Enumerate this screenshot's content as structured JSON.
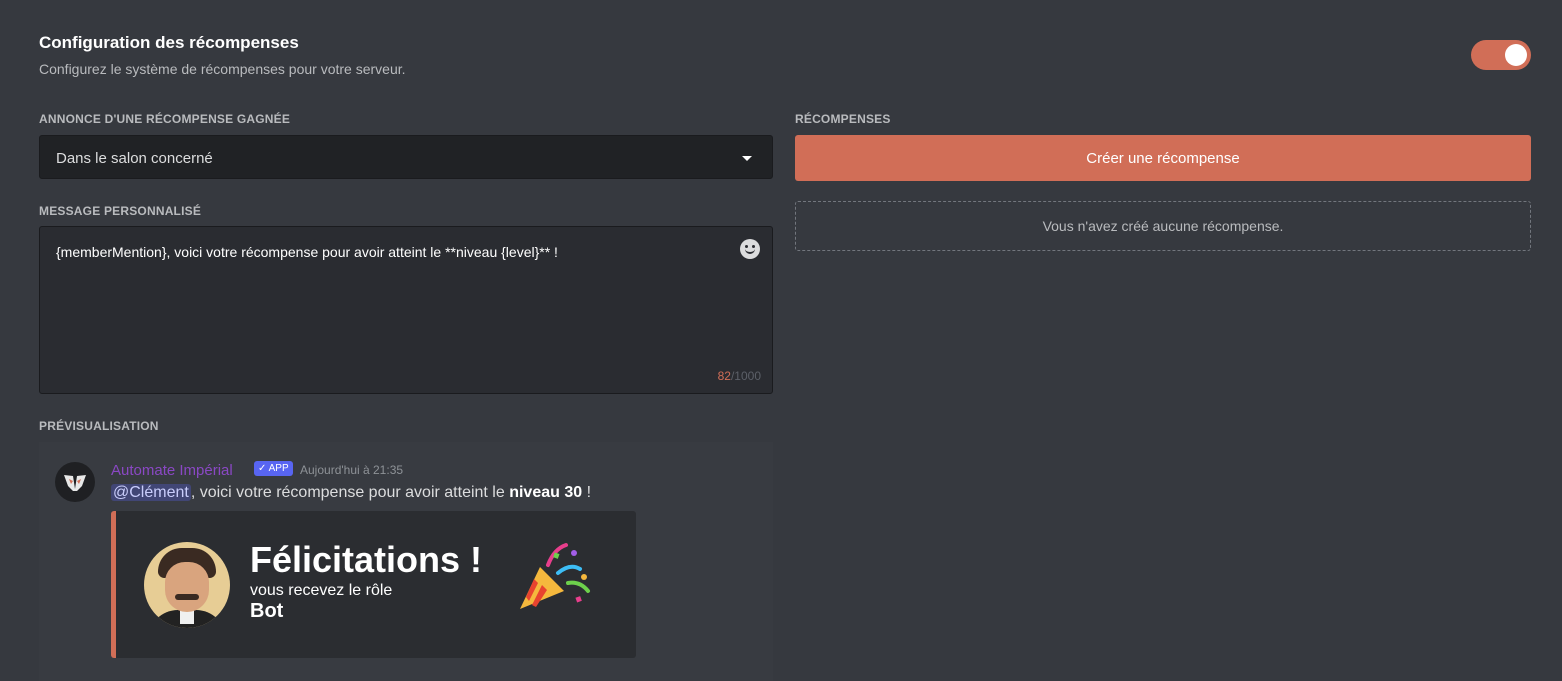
{
  "header": {
    "title": "Configuration des récompenses",
    "subtitle": "Configurez le système de récompenses pour votre serveur.",
    "toggle_on": true
  },
  "announcement": {
    "label": "ANNONCE D'UNE RÉCOMPENSE GAGNÉE",
    "selected": "Dans le salon concerné"
  },
  "message": {
    "label": "MESSAGE PERSONNALISÉ",
    "value": "{memberMention}, voici votre récompense pour avoir atteint le **niveau {level}** !",
    "count": "82",
    "max": "/1000"
  },
  "preview": {
    "label": "PRÉVISUALISATION",
    "author": "Automate Impérial",
    "badge": "✓ APP",
    "timestamp": "Aujourd'hui à 21:35",
    "mention": "@Clément",
    "text_before": ", voici votre récompense pour avoir atteint le ",
    "text_bold": "niveau 30",
    "text_after": " !",
    "card": {
      "title": "Félicitations !",
      "subtitle": "vous recevez le rôle",
      "role": "Bot"
    }
  },
  "rewards": {
    "label": "RÉCOMPENSES",
    "create_label": "Créer une récompense",
    "empty_text": "Vous n'avez créé aucune récompense."
  },
  "colors": {
    "accent": "#d16e57",
    "background": "#36393f",
    "input_bg": "#202225",
    "mention_bg": "#414675",
    "badge": "#5865f2",
    "author": "#8a48c4"
  },
  "icons": {
    "toggle": "toggle-switch-on",
    "caret": "chevron-down-icon",
    "emoji": "smiley-icon",
    "bot_avatar": "bot-logo-icon",
    "party": "party-popper-icon"
  }
}
